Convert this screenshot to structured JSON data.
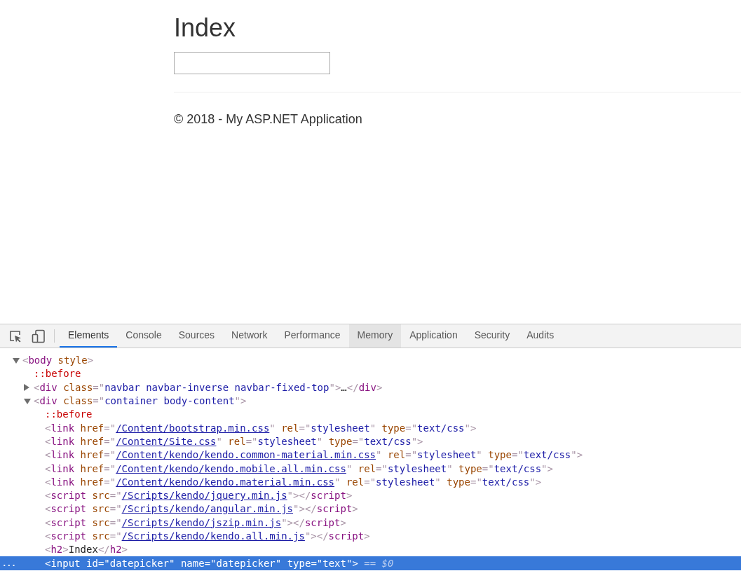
{
  "page": {
    "heading": "Index",
    "footer": "© 2018 - My ASP.NET Application"
  },
  "devtools": {
    "tabs": [
      {
        "label": "Elements",
        "selected": true,
        "hovered": false
      },
      {
        "label": "Console",
        "selected": false,
        "hovered": false
      },
      {
        "label": "Sources",
        "selected": false,
        "hovered": false
      },
      {
        "label": "Network",
        "selected": false,
        "hovered": false
      },
      {
        "label": "Performance",
        "selected": false,
        "hovered": false
      },
      {
        "label": "Memory",
        "selected": false,
        "hovered": true
      },
      {
        "label": "Application",
        "selected": false,
        "hovered": false
      },
      {
        "label": "Security",
        "selected": false,
        "hovered": false
      },
      {
        "label": "Audits",
        "selected": false,
        "hovered": false
      }
    ],
    "selected_gutter": "...",
    "tree": [
      {
        "expanded": true,
        "selected": false,
        "tokens": [
          {
            "kind": "punct",
            "text": "<"
          },
          {
            "kind": "tag",
            "text": "body"
          },
          {
            "kind": "attr",
            "text": " style"
          },
          {
            "kind": "punct",
            "text": ">"
          }
        ],
        "children": [
          {
            "selected": false,
            "tokens": [
              {
                "kind": "pseudo",
                "text": "::before"
              }
            ]
          },
          {
            "expanded": false,
            "selected": false,
            "tokens": [
              {
                "kind": "punct",
                "text": "<"
              },
              {
                "kind": "tag",
                "text": "div"
              },
              {
                "kind": "attr",
                "text": " class"
              },
              {
                "kind": "punct",
                "text": "=\""
              },
              {
                "kind": "value",
                "text": "navbar navbar-inverse navbar-fixed-top"
              },
              {
                "kind": "punct",
                "text": "\">"
              },
              {
                "kind": "text",
                "text": "…"
              },
              {
                "kind": "punct",
                "text": "</"
              },
              {
                "kind": "tag",
                "text": "div"
              },
              {
                "kind": "punct",
                "text": ">"
              }
            ]
          },
          {
            "expanded": true,
            "selected": false,
            "tokens": [
              {
                "kind": "punct",
                "text": "<"
              },
              {
                "kind": "tag",
                "text": "div"
              },
              {
                "kind": "attr",
                "text": " class"
              },
              {
                "kind": "punct",
                "text": "=\""
              },
              {
                "kind": "value",
                "text": "container body-content"
              },
              {
                "kind": "punct",
                "text": "\">"
              }
            ],
            "children": [
              {
                "selected": false,
                "tokens": [
                  {
                    "kind": "pseudo",
                    "text": "::before"
                  }
                ]
              },
              {
                "selected": false,
                "tokens": [
                  {
                    "kind": "punct",
                    "text": "<"
                  },
                  {
                    "kind": "tag",
                    "text": "link"
                  },
                  {
                    "kind": "attr",
                    "text": " href"
                  },
                  {
                    "kind": "punct",
                    "text": "=\""
                  },
                  {
                    "kind": "link",
                    "text": "/Content/bootstrap.min.css"
                  },
                  {
                    "kind": "punct",
                    "text": "\""
                  },
                  {
                    "kind": "attr",
                    "text": " rel"
                  },
                  {
                    "kind": "punct",
                    "text": "=\""
                  },
                  {
                    "kind": "value",
                    "text": "stylesheet"
                  },
                  {
                    "kind": "punct",
                    "text": "\""
                  },
                  {
                    "kind": "attr",
                    "text": " type"
                  },
                  {
                    "kind": "punct",
                    "text": "=\""
                  },
                  {
                    "kind": "value",
                    "text": "text/css"
                  },
                  {
                    "kind": "punct",
                    "text": "\">"
                  }
                ]
              },
              {
                "selected": false,
                "tokens": [
                  {
                    "kind": "punct",
                    "text": "<"
                  },
                  {
                    "kind": "tag",
                    "text": "link"
                  },
                  {
                    "kind": "attr",
                    "text": " href"
                  },
                  {
                    "kind": "punct",
                    "text": "=\""
                  },
                  {
                    "kind": "link",
                    "text": "/Content/Site.css"
                  },
                  {
                    "kind": "punct",
                    "text": "\""
                  },
                  {
                    "kind": "attr",
                    "text": " rel"
                  },
                  {
                    "kind": "punct",
                    "text": "=\""
                  },
                  {
                    "kind": "value",
                    "text": "stylesheet"
                  },
                  {
                    "kind": "punct",
                    "text": "\""
                  },
                  {
                    "kind": "attr",
                    "text": " type"
                  },
                  {
                    "kind": "punct",
                    "text": "=\""
                  },
                  {
                    "kind": "value",
                    "text": "text/css"
                  },
                  {
                    "kind": "punct",
                    "text": "\">"
                  }
                ]
              },
              {
                "selected": false,
                "tokens": [
                  {
                    "kind": "punct",
                    "text": "<"
                  },
                  {
                    "kind": "tag",
                    "text": "link"
                  },
                  {
                    "kind": "attr",
                    "text": " href"
                  },
                  {
                    "kind": "punct",
                    "text": "=\""
                  },
                  {
                    "kind": "link",
                    "text": "/Content/kendo/kendo.common-material.min.css"
                  },
                  {
                    "kind": "punct",
                    "text": "\""
                  },
                  {
                    "kind": "attr",
                    "text": " rel"
                  },
                  {
                    "kind": "punct",
                    "text": "=\""
                  },
                  {
                    "kind": "value",
                    "text": "stylesheet"
                  },
                  {
                    "kind": "punct",
                    "text": "\""
                  },
                  {
                    "kind": "attr",
                    "text": " type"
                  },
                  {
                    "kind": "punct",
                    "text": "=\""
                  },
                  {
                    "kind": "value",
                    "text": "text/css"
                  },
                  {
                    "kind": "punct",
                    "text": "\">"
                  }
                ]
              },
              {
                "selected": false,
                "tokens": [
                  {
                    "kind": "punct",
                    "text": "<"
                  },
                  {
                    "kind": "tag",
                    "text": "link"
                  },
                  {
                    "kind": "attr",
                    "text": " href"
                  },
                  {
                    "kind": "punct",
                    "text": "=\""
                  },
                  {
                    "kind": "link",
                    "text": "/Content/kendo/kendo.mobile.all.min.css"
                  },
                  {
                    "kind": "punct",
                    "text": "\""
                  },
                  {
                    "kind": "attr",
                    "text": " rel"
                  },
                  {
                    "kind": "punct",
                    "text": "=\""
                  },
                  {
                    "kind": "value",
                    "text": "stylesheet"
                  },
                  {
                    "kind": "punct",
                    "text": "\""
                  },
                  {
                    "kind": "attr",
                    "text": " type"
                  },
                  {
                    "kind": "punct",
                    "text": "=\""
                  },
                  {
                    "kind": "value",
                    "text": "text/css"
                  },
                  {
                    "kind": "punct",
                    "text": "\">"
                  }
                ]
              },
              {
                "selected": false,
                "tokens": [
                  {
                    "kind": "punct",
                    "text": "<"
                  },
                  {
                    "kind": "tag",
                    "text": "link"
                  },
                  {
                    "kind": "attr",
                    "text": " href"
                  },
                  {
                    "kind": "punct",
                    "text": "=\""
                  },
                  {
                    "kind": "link",
                    "text": "/Content/kendo/kendo.material.min.css"
                  },
                  {
                    "kind": "punct",
                    "text": "\""
                  },
                  {
                    "kind": "attr",
                    "text": " rel"
                  },
                  {
                    "kind": "punct",
                    "text": "=\""
                  },
                  {
                    "kind": "value",
                    "text": "stylesheet"
                  },
                  {
                    "kind": "punct",
                    "text": "\""
                  },
                  {
                    "kind": "attr",
                    "text": " type"
                  },
                  {
                    "kind": "punct",
                    "text": "=\""
                  },
                  {
                    "kind": "value",
                    "text": "text/css"
                  },
                  {
                    "kind": "punct",
                    "text": "\">"
                  }
                ]
              },
              {
                "selected": false,
                "tokens": [
                  {
                    "kind": "punct",
                    "text": "<"
                  },
                  {
                    "kind": "tag",
                    "text": "script"
                  },
                  {
                    "kind": "attr",
                    "text": " src"
                  },
                  {
                    "kind": "punct",
                    "text": "=\""
                  },
                  {
                    "kind": "link",
                    "text": "/Scripts/kendo/jquery.min.js"
                  },
                  {
                    "kind": "punct",
                    "text": "\">"
                  },
                  {
                    "kind": "punct",
                    "text": "</"
                  },
                  {
                    "kind": "tag",
                    "text": "script"
                  },
                  {
                    "kind": "punct",
                    "text": ">"
                  }
                ]
              },
              {
                "selected": false,
                "tokens": [
                  {
                    "kind": "punct",
                    "text": "<"
                  },
                  {
                    "kind": "tag",
                    "text": "script"
                  },
                  {
                    "kind": "attr",
                    "text": " src"
                  },
                  {
                    "kind": "punct",
                    "text": "=\""
                  },
                  {
                    "kind": "link",
                    "text": "/Scripts/kendo/angular.min.js"
                  },
                  {
                    "kind": "punct",
                    "text": "\">"
                  },
                  {
                    "kind": "punct",
                    "text": "</"
                  },
                  {
                    "kind": "tag",
                    "text": "script"
                  },
                  {
                    "kind": "punct",
                    "text": ">"
                  }
                ]
              },
              {
                "selected": false,
                "tokens": [
                  {
                    "kind": "punct",
                    "text": "<"
                  },
                  {
                    "kind": "tag",
                    "text": "script"
                  },
                  {
                    "kind": "attr",
                    "text": " src"
                  },
                  {
                    "kind": "punct",
                    "text": "=\""
                  },
                  {
                    "kind": "link",
                    "text": "/Scripts/kendo/jszip.min.js"
                  },
                  {
                    "kind": "punct",
                    "text": "\">"
                  },
                  {
                    "kind": "punct",
                    "text": "</"
                  },
                  {
                    "kind": "tag",
                    "text": "script"
                  },
                  {
                    "kind": "punct",
                    "text": ">"
                  }
                ]
              },
              {
                "selected": false,
                "tokens": [
                  {
                    "kind": "punct",
                    "text": "<"
                  },
                  {
                    "kind": "tag",
                    "text": "script"
                  },
                  {
                    "kind": "attr",
                    "text": " src"
                  },
                  {
                    "kind": "punct",
                    "text": "=\""
                  },
                  {
                    "kind": "link",
                    "text": "/Scripts/kendo/kendo.all.min.js"
                  },
                  {
                    "kind": "punct",
                    "text": "\">"
                  },
                  {
                    "kind": "punct",
                    "text": "</"
                  },
                  {
                    "kind": "tag",
                    "text": "script"
                  },
                  {
                    "kind": "punct",
                    "text": ">"
                  }
                ]
              },
              {
                "selected": false,
                "tokens": [
                  {
                    "kind": "punct",
                    "text": "<"
                  },
                  {
                    "kind": "tag",
                    "text": "h2"
                  },
                  {
                    "kind": "punct",
                    "text": ">"
                  },
                  {
                    "kind": "text",
                    "text": "Index"
                  },
                  {
                    "kind": "punct",
                    "text": "</"
                  },
                  {
                    "kind": "tag",
                    "text": "h2"
                  },
                  {
                    "kind": "punct",
                    "text": ">"
                  }
                ]
              },
              {
                "selected": true,
                "tokens": [
                  {
                    "kind": "punct",
                    "text": "<"
                  },
                  {
                    "kind": "tag",
                    "text": "input"
                  },
                  {
                    "kind": "attr",
                    "text": " id"
                  },
                  {
                    "kind": "punct",
                    "text": "=\""
                  },
                  {
                    "kind": "value",
                    "text": "datepicker"
                  },
                  {
                    "kind": "punct",
                    "text": "\""
                  },
                  {
                    "kind": "attr",
                    "text": " name"
                  },
                  {
                    "kind": "punct",
                    "text": "=\""
                  },
                  {
                    "kind": "value",
                    "text": "datepicker"
                  },
                  {
                    "kind": "punct",
                    "text": "\""
                  },
                  {
                    "kind": "attr",
                    "text": " type"
                  },
                  {
                    "kind": "punct",
                    "text": "=\""
                  },
                  {
                    "kind": "value",
                    "text": "text"
                  },
                  {
                    "kind": "punct",
                    "text": "\">"
                  },
                  {
                    "kind": "ref",
                    "text": " == $0"
                  }
                ]
              }
            ]
          }
        ]
      }
    ]
  }
}
